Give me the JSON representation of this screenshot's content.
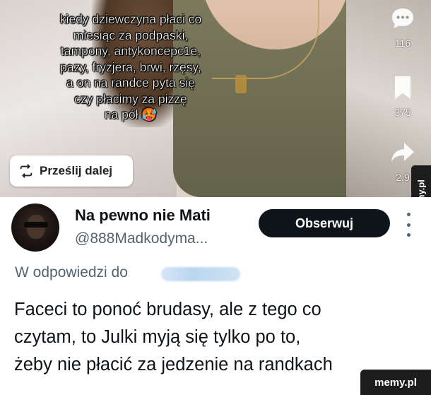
{
  "video": {
    "caption_lines": [
      "kiedy dziewczyna płaci co",
      "miesiąc za podpaski,",
      "tampony, antykoncepc1e,",
      "pazy, fryzjera, brwi, rzęsy,",
      "a on na randce pyta się",
      "czy płacimy za pizzę",
      "na pół 🥵"
    ],
    "share_label": "Prześlij dalej",
    "comments_count": "116",
    "saves_count": "375",
    "shares_count": "2,9",
    "icons": {
      "share_pill": "repost-icon",
      "comment": "comment-icon",
      "save": "bookmark-icon",
      "share": "share-arrow-icon"
    }
  },
  "tweet": {
    "display_name": "Na pewno nie Mati",
    "handle": "@888Madkodyma...",
    "follow_label": "Obserwuj",
    "reply_prefix": "W odpowiedzi do",
    "text_lines": [
      "Faceci to ponoć brudasy, ale z tego co",
      "czytam, to Julki myją się tylko po to,",
      "żeby nie płacić za jedzenie na randkach"
    ]
  },
  "watermark": {
    "side": "memy.pl",
    "bottom": "memy.pl"
  },
  "colors": {
    "text_primary": "#0f1419",
    "text_secondary": "#536471",
    "follow_bg": "#0f1419",
    "watermark_bg": "#1d1d1d"
  }
}
